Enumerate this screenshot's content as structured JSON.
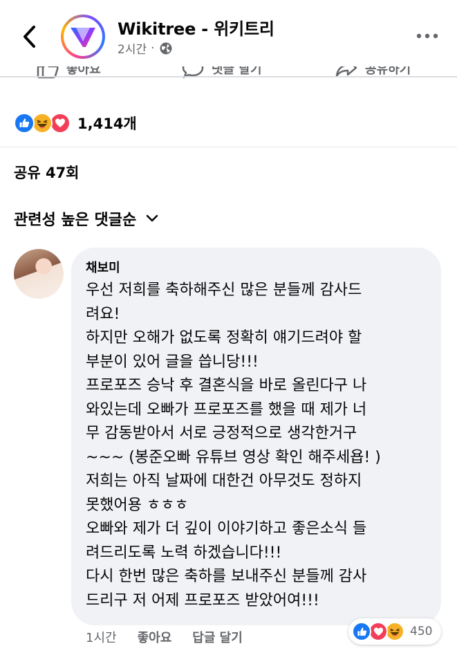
{
  "header": {
    "page_name": "Wikitree - 위키트리",
    "time": "2시간",
    "separator": "·",
    "back_icon": "chevron-left-icon",
    "more_icon": "more-horizontal-icon",
    "logo_icon": "wikitree-logo"
  },
  "post": {
    "action_bar": {
      "like": "좋아요",
      "comment": "댓글 달기",
      "share": "공유하기"
    },
    "reaction_count": "1,414개",
    "reactions": [
      "like",
      "haha",
      "love"
    ],
    "shares": "공유 47회",
    "sort_label": "관련성 높은 댓글순"
  },
  "comment": {
    "author": "채보미",
    "lines": [
      "우선 저희를 축하해주신 많은 분들께 감사드",
      "려요!",
      "하지만 오해가 없도록 정확히 얘기드려야 할",
      "부분이 있어 글을 씁니당!!!",
      "프로포즈 승낙 후 결혼식을 바로 올린다구 나",
      "와있는데 오빠가 프로포즈를 했을 때 제가 너",
      "무 감동받아서 서로 긍정적으로 생각한거구",
      "~~~ (봉준오빠 유튜브 영상 확인 해주세욥! )",
      "저희는 아직 날짜에 대한건 아무것도 정하지",
      "못했어용 ㅎㅎㅎ",
      "오빠와 제가 더 깊이 이야기하고 좋은소식 들",
      "려드리도록 노력 하겠습니다!!!",
      "다시 한번 많은 축하를 보내주신 분들께 감사",
      "드리구 저 어제 프로포즈 받았어여!!!"
    ],
    "time": "1시간",
    "like_label": "좋아요",
    "reply_label": "답글 달기",
    "reactions": [
      "like",
      "love",
      "haha"
    ],
    "reaction_count": "450"
  },
  "colors": {
    "like_blue": "#1877f2",
    "love_red": "#f33e58",
    "haha_yellow": "#f7b125",
    "secondary_text": "#65676b",
    "bubble_bg": "#f0f2f5"
  }
}
